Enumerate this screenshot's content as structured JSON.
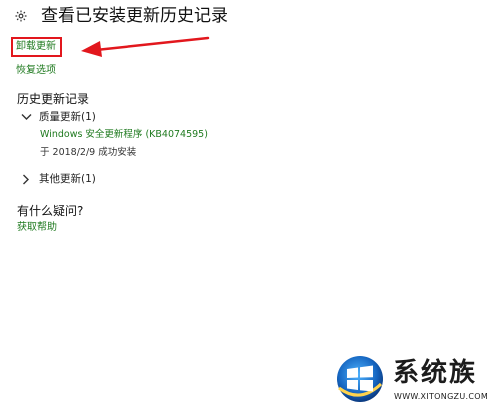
{
  "header": {
    "icon": "gear-icon",
    "title": "查看已安装更新历史记录"
  },
  "actions": {
    "uninstall_label": "卸载更新",
    "restore_label": "恢复选项"
  },
  "history": {
    "heading": "历史更新记录",
    "groups": [
      {
        "label": "质量更新(1)",
        "expanded": true,
        "items": [
          {
            "name": "Windows 安全更新程序 (KB4074595)",
            "status": "于 2018/2/9 成功安装"
          }
        ]
      },
      {
        "label": "其他更新(1)",
        "expanded": false
      }
    ]
  },
  "questions": {
    "heading": "有什么疑问?",
    "help_label": "获取帮助"
  },
  "watermark": {
    "brand": "系统族",
    "url": "WWW.XITONGZU.COM"
  },
  "colors": {
    "link": "#1f7a1f",
    "highlight": "#e2171d",
    "text": "#222222",
    "background": "#ffffff"
  }
}
